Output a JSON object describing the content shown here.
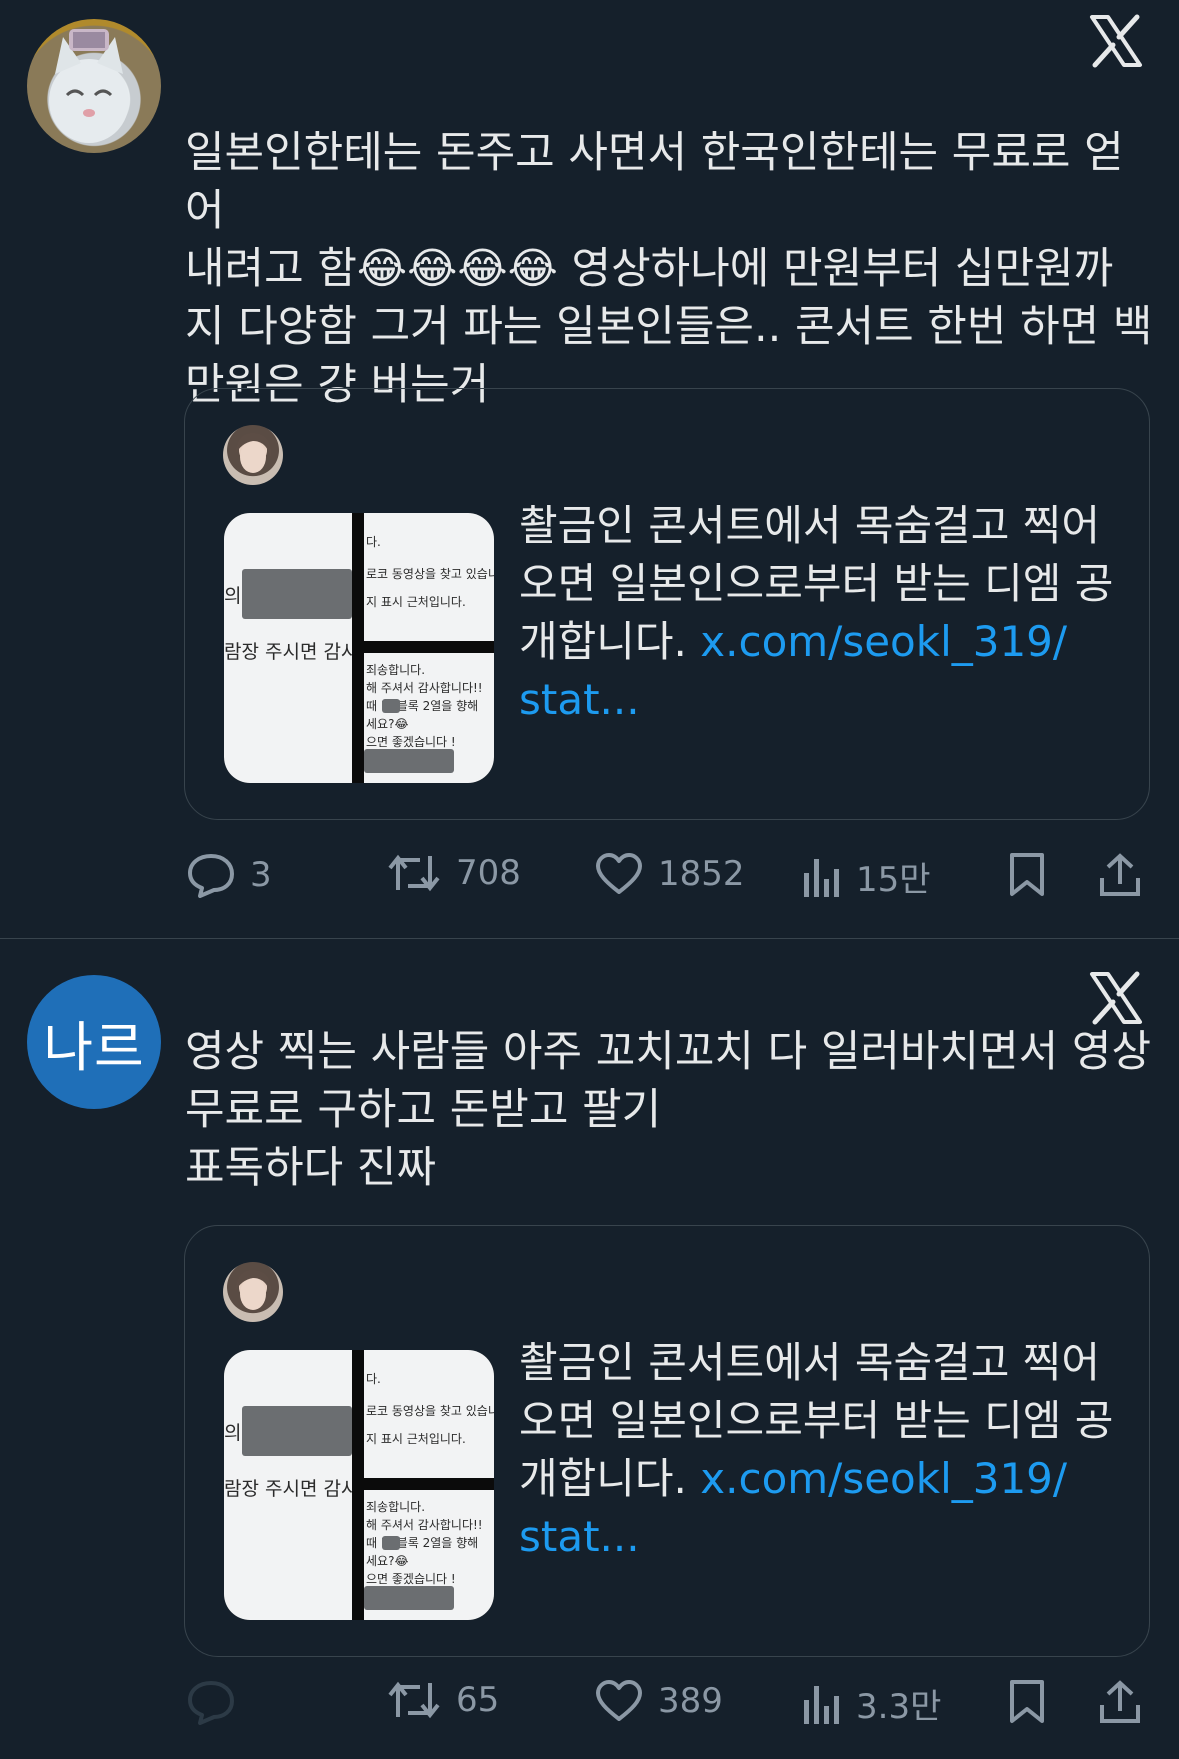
{
  "tweets": [
    {
      "avatar_icon": "cat-avatar-icon",
      "text": "일본인한테는 돈주고 사면서 한국인한테는 무료로 얻어\n내려고 함😂😂😂😂 영상하나에 만원부터 십만원까\n지 다양함 그거 파는 일본인들은.. 콘서트 한번 하면 백\n만원은 걍 버는거",
      "quote": {
        "text": "촬금인 콘서트에서 목숨걸고 찍어\n오면 일본인으로부터 받는 디엠 공\n개합니다. ",
        "link": "x.com/seokl_319/\nstat...",
        "thumb": {
          "left_a": "의",
          "left_b": "람장 주시면 감사",
          "rt_1": "다.",
          "rt_2": "로코 동영상을 찾고 있습니다",
          "rt_3": "지 표시 근처입니다.",
          "rb_1": "죄송합니다.",
          "rb_2": "해 주셔서 감사합니다!!",
          "rb_3": "때 B1블록 2열을 향해",
          "rb_4": "세요?😂",
          "rb_5": "으면 좋겠습니다 !"
        }
      },
      "actions": {
        "reply": "3",
        "retweet": "708",
        "like": "1852",
        "views": "15만"
      }
    },
    {
      "avatar_text": "나르",
      "text": "영상 찍는 사람들 아주 꼬치꼬치 다 일러바치면서 영상\n무료로 구하고 돈받고 팔기\n표독하다 진짜",
      "quote": {
        "text": "촬금인 콘서트에서 목숨걸고 찍어\n오면 일본인으로부터 받는 디엠 공\n개합니다. ",
        "link": "x.com/seokl_319/\nstat...",
        "thumb": {
          "left_a": "의",
          "left_b": "람장 주시면 감사",
          "rt_1": "다.",
          "rt_2": "로코 동영상을 찾고 있습니다",
          "rt_3": "지 표시 근처입니다.",
          "rb_1": "죄송합니다.",
          "rb_2": "해 주셔서 감사합니다!!",
          "rb_3": "때 B1블록 2열을 향해",
          "rb_4": "세요?😂",
          "rb_5": "으면 좋겠습니다 !"
        }
      },
      "actions": {
        "reply": "",
        "retweet": "65",
        "like": "389",
        "views": "3.3만"
      }
    }
  ],
  "colors": {
    "background": "#15202b",
    "text": "#e7e9ea",
    "muted": "#8b98a5",
    "link": "#1d9bf0",
    "border": "#38444d"
  }
}
